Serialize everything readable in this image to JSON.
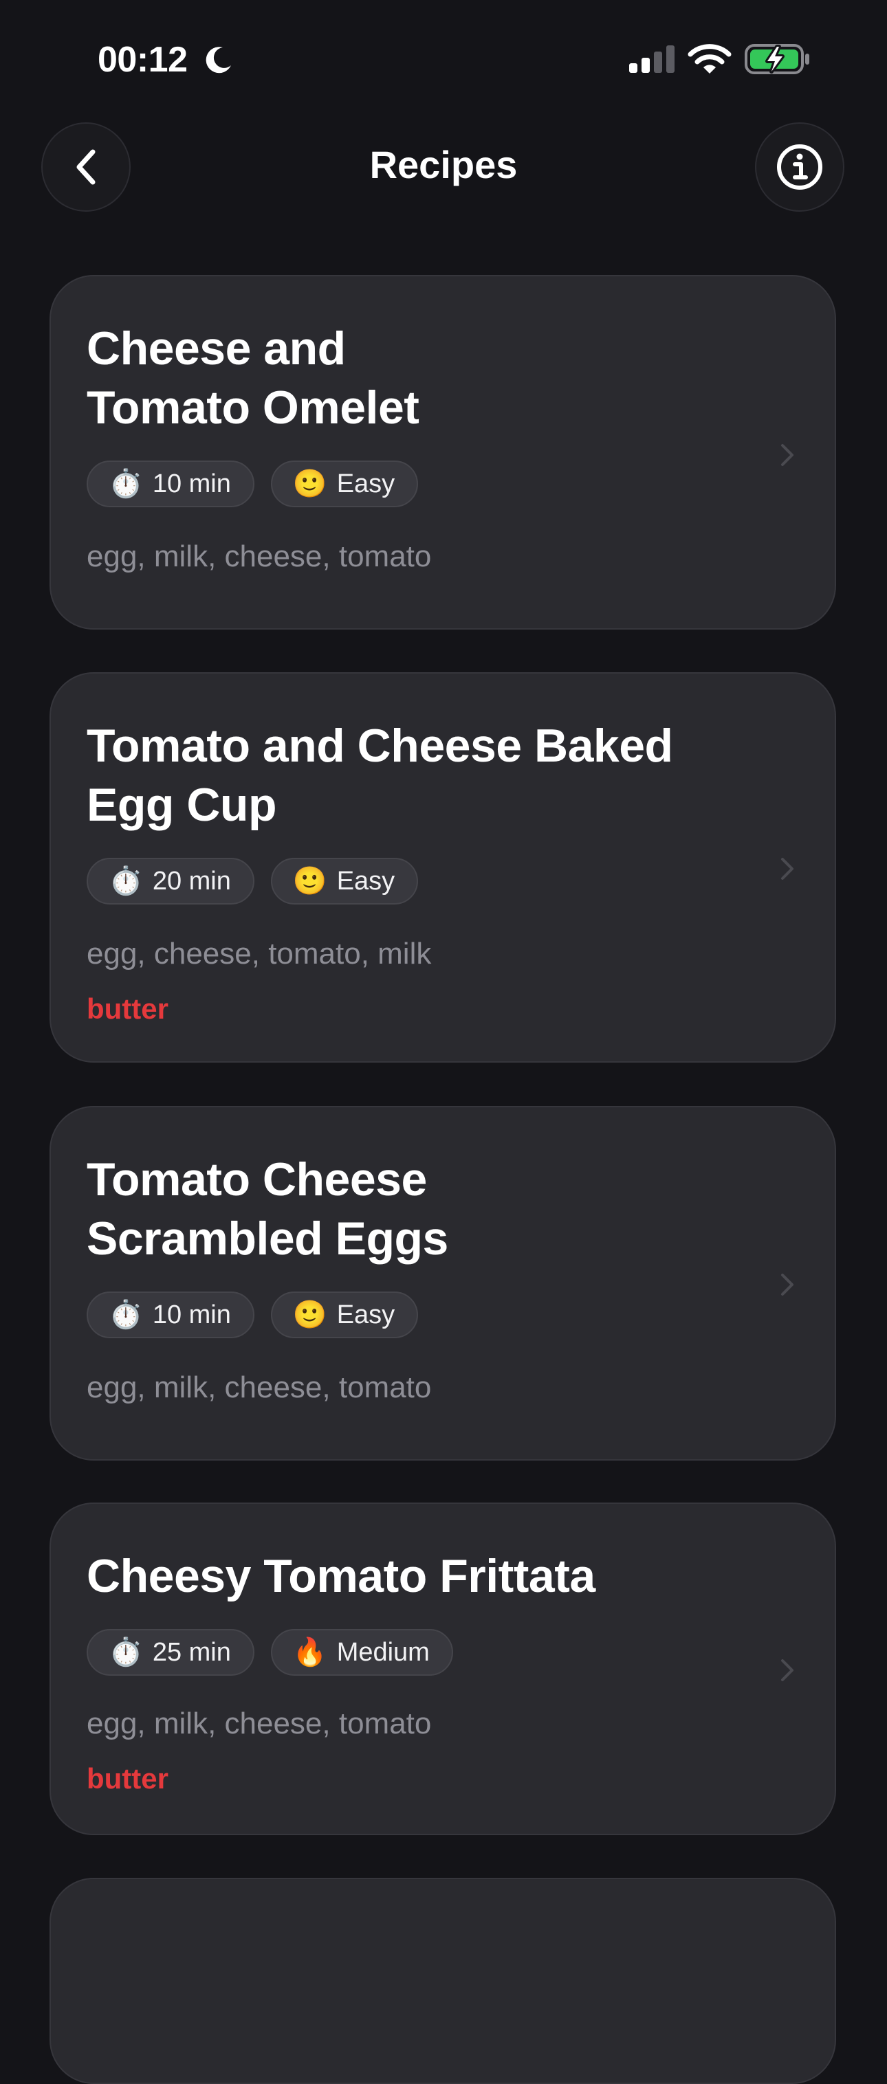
{
  "status_bar": {
    "time": "00:12"
  },
  "nav": {
    "title": "Recipes"
  },
  "recipes": [
    {
      "title": "Cheese and Tomato Omelet",
      "time": "10 min",
      "time_icon": "⏱️",
      "difficulty": "Easy",
      "difficulty_icon": "🙂",
      "ingredients": "egg, milk, cheese, tomato",
      "missing": ""
    },
    {
      "title": "Tomato and Cheese Baked Egg Cup",
      "time": "20 min",
      "time_icon": "⏱️",
      "difficulty": "Easy",
      "difficulty_icon": "🙂",
      "ingredients": "egg, cheese, tomato, milk",
      "missing": "butter"
    },
    {
      "title": "Tomato Cheese Scrambled Eggs",
      "time": "10 min",
      "time_icon": "⏱️",
      "difficulty": "Easy",
      "difficulty_icon": "🙂",
      "ingredients": "egg, milk, cheese, tomato",
      "missing": ""
    },
    {
      "title": "Cheesy Tomato Frittata",
      "time": "25 min",
      "time_icon": "⏱️",
      "difficulty": "Medium",
      "difficulty_icon": "🔥",
      "ingredients": "egg, milk, cheese, tomato",
      "missing": "butter"
    }
  ],
  "icons": {
    "back": "chevron-left-icon",
    "info": "info-circle-icon",
    "row": "chevron-right-icon"
  },
  "colors": {
    "background": "#141418",
    "card": "#2a2a2f",
    "missing_ingredient": "#e5393c",
    "battery": "#34c759"
  }
}
